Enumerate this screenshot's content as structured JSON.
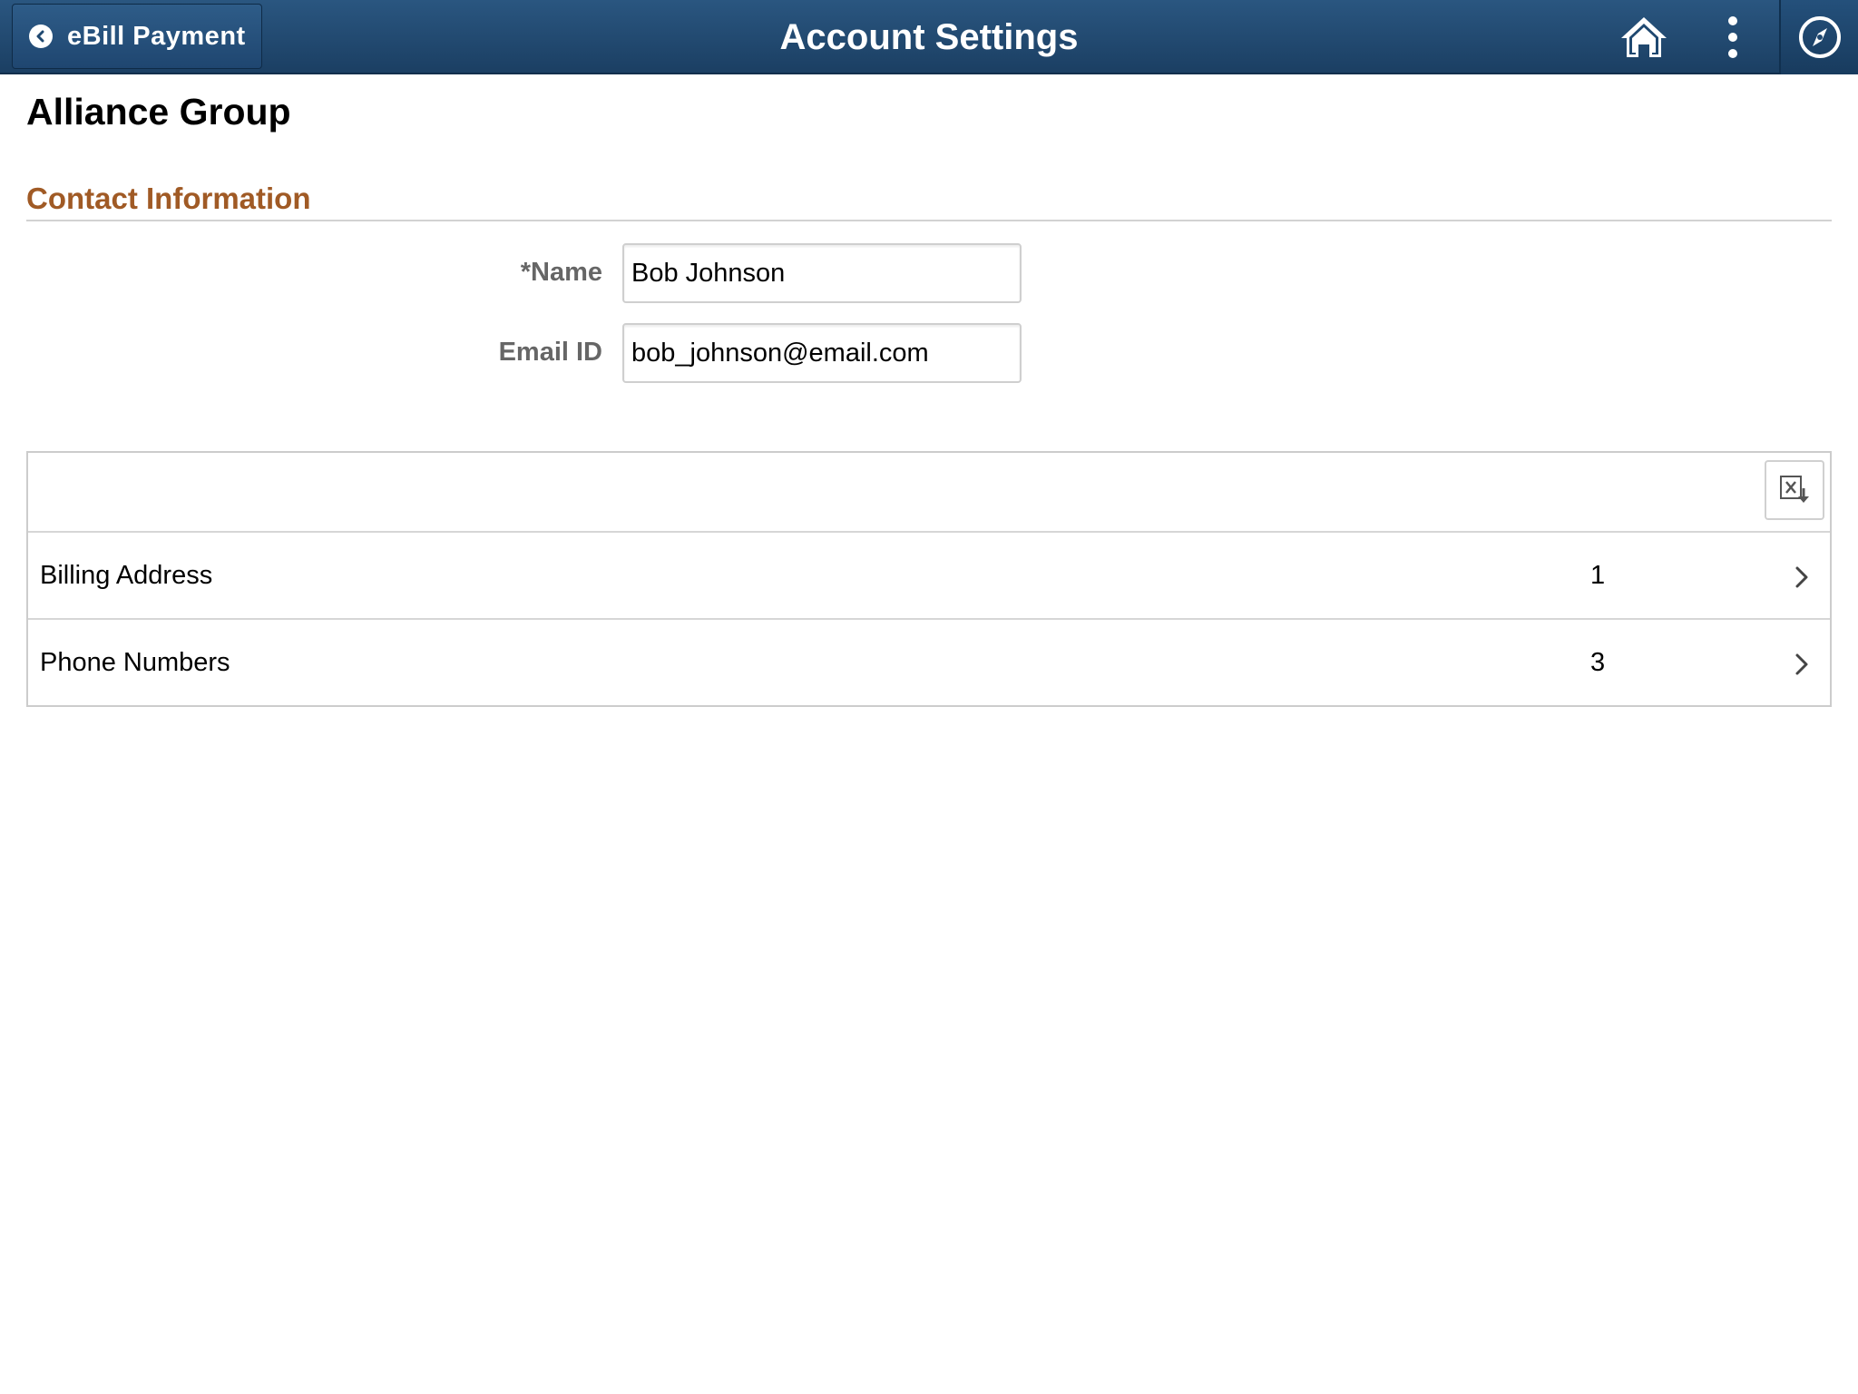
{
  "header": {
    "back_label": "eBill Payment",
    "title": "Account Settings",
    "icons": {
      "back": "chevron-left-icon",
      "home": "home-icon",
      "actions": "vertical-ellipsis-icon",
      "navbar": "compass-icon"
    },
    "colors": {
      "bar": "#1f4870",
      "text": "#ffffff"
    }
  },
  "page": {
    "title": "Alliance Group",
    "section_title": "Contact Information",
    "section_title_color": "#a05a25"
  },
  "form": {
    "name_label": "*Name",
    "name_value": "Bob Johnson",
    "email_label": "Email ID",
    "email_value": "bob_johnson@email.com"
  },
  "grid": {
    "toolbar_icon": "export-to-excel-icon",
    "rows": [
      {
        "label": "Billing Address",
        "count": "1"
      },
      {
        "label": "Phone Numbers",
        "count": "3"
      }
    ]
  }
}
